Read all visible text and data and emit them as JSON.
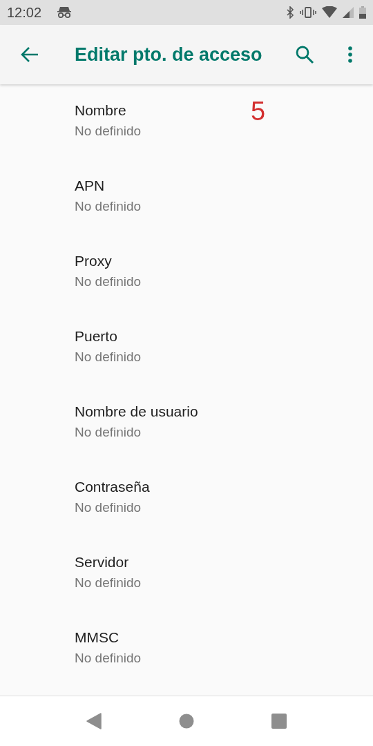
{
  "status_bar": {
    "time": "12:02"
  },
  "app_bar": {
    "title": "Editar pto. de acceso"
  },
  "annotation": "5",
  "settings": [
    {
      "title": "Nombre",
      "summary": "No definido"
    },
    {
      "title": "APN",
      "summary": "No definido"
    },
    {
      "title": "Proxy",
      "summary": "No definido"
    },
    {
      "title": "Puerto",
      "summary": "No definido"
    },
    {
      "title": "Nombre de usuario",
      "summary": "No definido"
    },
    {
      "title": "Contraseña",
      "summary": "No definido"
    },
    {
      "title": "Servidor",
      "summary": "No definido"
    },
    {
      "title": "MMSC",
      "summary": "No definido"
    }
  ]
}
